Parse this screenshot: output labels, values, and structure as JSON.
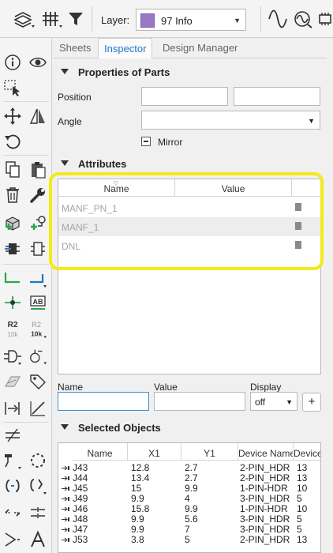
{
  "toolbar": {
    "layer_label": "Layer:",
    "layer_value": "97 Info",
    "layer_color": "#9a78c8"
  },
  "tabs": [
    {
      "label": "Sheets",
      "active": false
    },
    {
      "label": "Inspector",
      "active": true
    },
    {
      "label": "Design Manager",
      "active": false
    }
  ],
  "properties": {
    "title": "Properties of Parts",
    "position_label": "Position",
    "angle_label": "Angle",
    "mirror_label": "Mirror"
  },
  "attributes": {
    "title": "Attributes",
    "columns": [
      "Name",
      "Value"
    ],
    "rows": [
      {
        "name": "MANF_PN_1"
      },
      {
        "name": "MANF_1"
      },
      {
        "name": "DNL"
      }
    ],
    "editor": {
      "name_label": "Name",
      "value_label": "Value",
      "display_label": "Display",
      "display_value": "off",
      "add_label": "+"
    }
  },
  "selected": {
    "title": "Selected Objects",
    "columns": [
      "Name",
      "X1",
      "Y1",
      "Device Name",
      "Device"
    ],
    "rows": [
      [
        "J43",
        "12.8",
        "2.7",
        "2-PIN_HDR",
        "13"
      ],
      [
        "J44",
        "13.4",
        "2.7",
        "2-PIN_HDR",
        "13"
      ],
      [
        "J45",
        "15",
        "9.9",
        "1-PIN-HDR",
        "10"
      ],
      [
        "J49",
        "9.9",
        "4",
        "3-PIN_HDR",
        "5"
      ],
      [
        "J46",
        "15.8",
        "9.9",
        "1-PIN-HDR",
        "10"
      ],
      [
        "J48",
        "9.9",
        "5.6",
        "3-PIN_HDR",
        "5"
      ],
      [
        "J47",
        "9.9",
        "7",
        "3-PIN_HDR",
        "5"
      ],
      [
        "J53",
        "3.8",
        "5",
        "2-PIN_HDR",
        "13"
      ]
    ]
  }
}
